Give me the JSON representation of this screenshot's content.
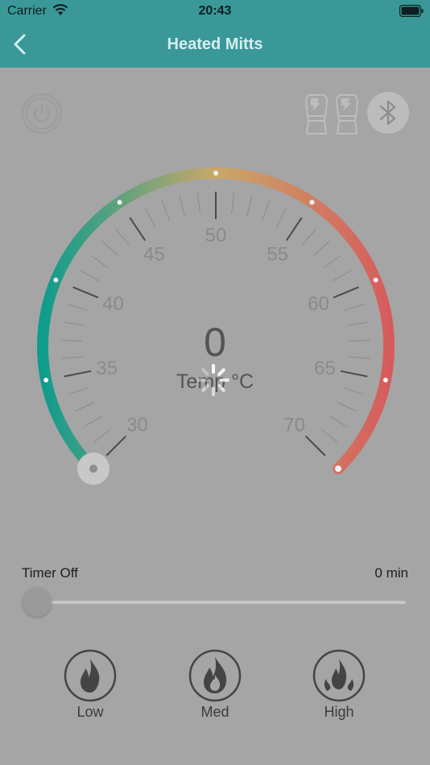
{
  "status_bar": {
    "carrier": "Carrier",
    "time": "20:43"
  },
  "nav": {
    "title": "Heated Mitts"
  },
  "gauge": {
    "current_temp": "0",
    "unit_label": "Temp °C",
    "min": 30,
    "max": 70,
    "value": 30,
    "tick_labels": [
      "30",
      "35",
      "40",
      "45",
      "50",
      "55",
      "60",
      "65",
      "70"
    ]
  },
  "timer": {
    "label": "Timer Off",
    "value": "0 min",
    "level": 0
  },
  "heat_levels": [
    {
      "label": "Low",
      "icon": "flame-low-icon"
    },
    {
      "label": "Med",
      "icon": "flame-med-icon"
    },
    {
      "label": "High",
      "icon": "flame-high-icon"
    }
  ],
  "colors": {
    "header": "#3a9898",
    "background": "#a5a5a5",
    "gauge_start": "#0e9c8d",
    "gauge_mid": "#c9a869",
    "gauge_end": "#d65c5c"
  }
}
